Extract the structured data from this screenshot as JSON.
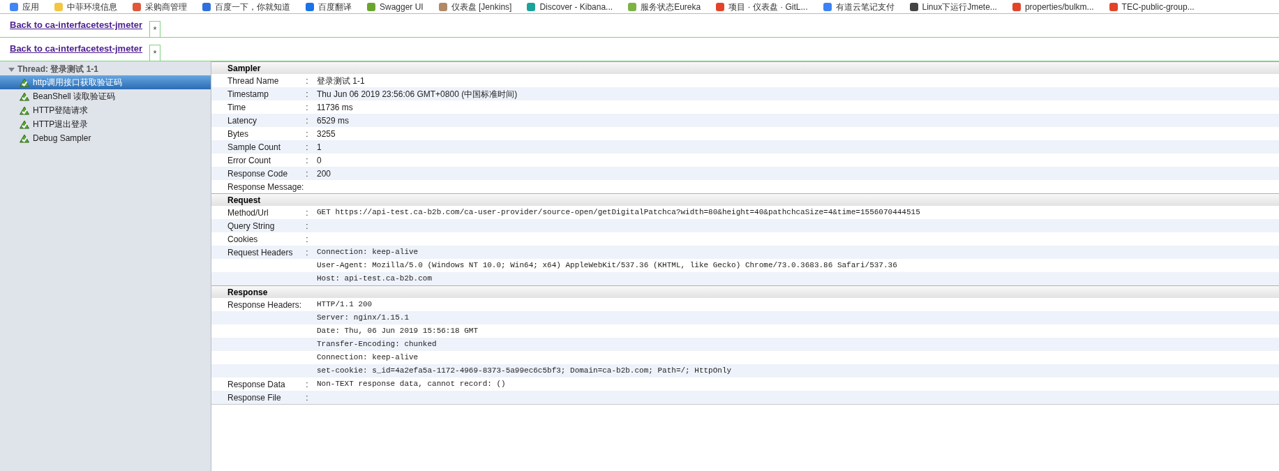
{
  "bookmarks": [
    {
      "label": "应用",
      "color": "#4285f4"
    },
    {
      "label": "中菲环境信息",
      "color": "#f4c542"
    },
    {
      "label": "采购商管理",
      "color": "#e0573a"
    },
    {
      "label": "百度一下，你就知道",
      "color": "#2f6fe0"
    },
    {
      "label": "百度翻译",
      "color": "#1a73e8"
    },
    {
      "label": "Swagger UI",
      "color": "#6aa62c"
    },
    {
      "label": "仪表盘 [Jenkins]",
      "color": "#b08968"
    },
    {
      "label": "Discover - Kibana...",
      "color": "#1aa39a"
    },
    {
      "label": "服务状态Eureka",
      "color": "#7cb342"
    },
    {
      "label": "项目 · 仪表盘 · GitL...",
      "color": "#e24329"
    },
    {
      "label": "有道云笔记支付",
      "color": "#3b82f6"
    },
    {
      "label": "Linux下运行Jmete...",
      "color": "#444444"
    },
    {
      "label": "properties/bulkm...",
      "color": "#e24329"
    },
    {
      "label": "TEC-public-group...",
      "color": "#e24329"
    }
  ],
  "back_links": [
    {
      "label": "Back to ca-interfacetest-jmeter",
      "badge": "*"
    },
    {
      "label": "Back to ca-interfacetest-jmeter",
      "badge": "*"
    }
  ],
  "tree": {
    "label": "Thread: 登录测试 1-1",
    "expanded": true,
    "children": [
      {
        "label": "http调用接口获取验证码",
        "selected": true
      },
      {
        "label": "BeanShell 读取验证码",
        "selected": false
      },
      {
        "label": "HTTP登陆请求",
        "selected": false
      },
      {
        "label": "HTTP退出登录",
        "selected": false
      },
      {
        "label": "Debug Sampler",
        "selected": false
      }
    ]
  },
  "sections": [
    {
      "title": "Sampler",
      "kind": "text",
      "rows": [
        {
          "key": "Thread Name",
          "separator": ":",
          "values": [
            "登录测试 1-1"
          ]
        },
        {
          "key": "Timestamp",
          "separator": ":",
          "values": [
            "Thu Jun 06 2019 23:56:06 GMT+0800 (中国标准时间)"
          ]
        },
        {
          "key": "Time",
          "separator": ":",
          "values": [
            "11736 ms"
          ]
        },
        {
          "key": "Latency",
          "separator": ":",
          "values": [
            "6529 ms"
          ]
        },
        {
          "key": "Bytes",
          "separator": ":",
          "values": [
            "3255"
          ]
        },
        {
          "key": "Sample Count",
          "separator": ":",
          "values": [
            "1"
          ]
        },
        {
          "key": "Error Count",
          "separator": ":",
          "values": [
            "0"
          ]
        },
        {
          "key": "Response Code",
          "separator": ":",
          "values": [
            "200"
          ]
        },
        {
          "key": "Response Message:",
          "values": []
        }
      ]
    },
    {
      "title": "Request",
      "kind": "code",
      "rows": [
        {
          "key": "Method/Url",
          "separator": ":",
          "values": [
            "GET https://api-test.ca-b2b.com/ca-user-provider/source-open/getDigitalPatchca?width=80&height=40&pathchcaSize=4&time=1556070444515"
          ]
        },
        {
          "key": "Query String",
          "separator": ":",
          "values": []
        },
        {
          "key": "Cookies",
          "separator": ":",
          "values": []
        },
        {
          "key": "Request Headers",
          "separator": ":",
          "values": [
            "Connection: keep-alive",
            "User-Agent: Mozilla/5.0 (Windows NT 10.0; Win64; x64) AppleWebKit/537.36 (KHTML, like Gecko) Chrome/73.0.3683.86 Safari/537.36",
            "Host: api-test.ca-b2b.com"
          ]
        }
      ]
    },
    {
      "title": "Response",
      "kind": "code",
      "rows": [
        {
          "key": "Response Headers:",
          "values": [
            "HTTP/1.1 200",
            "Server: nginx/1.15.1",
            "Date: Thu, 06 Jun 2019 15:56:18 GMT",
            "Transfer-Encoding: chunked",
            "Connection: keep-alive",
            "set-cookie: s_id=4a2efa5a-1172-4969-8373-5a99ec6c5bf3; Domain=ca-b2b.com; Path=/; HttpOnly"
          ]
        },
        {
          "key": "Response Data",
          "separator": ":",
          "values": [
            "Non-TEXT response data, cannot record: ()"
          ]
        },
        {
          "key": "Response File",
          "separator": ":",
          "values": []
        }
      ]
    }
  ]
}
